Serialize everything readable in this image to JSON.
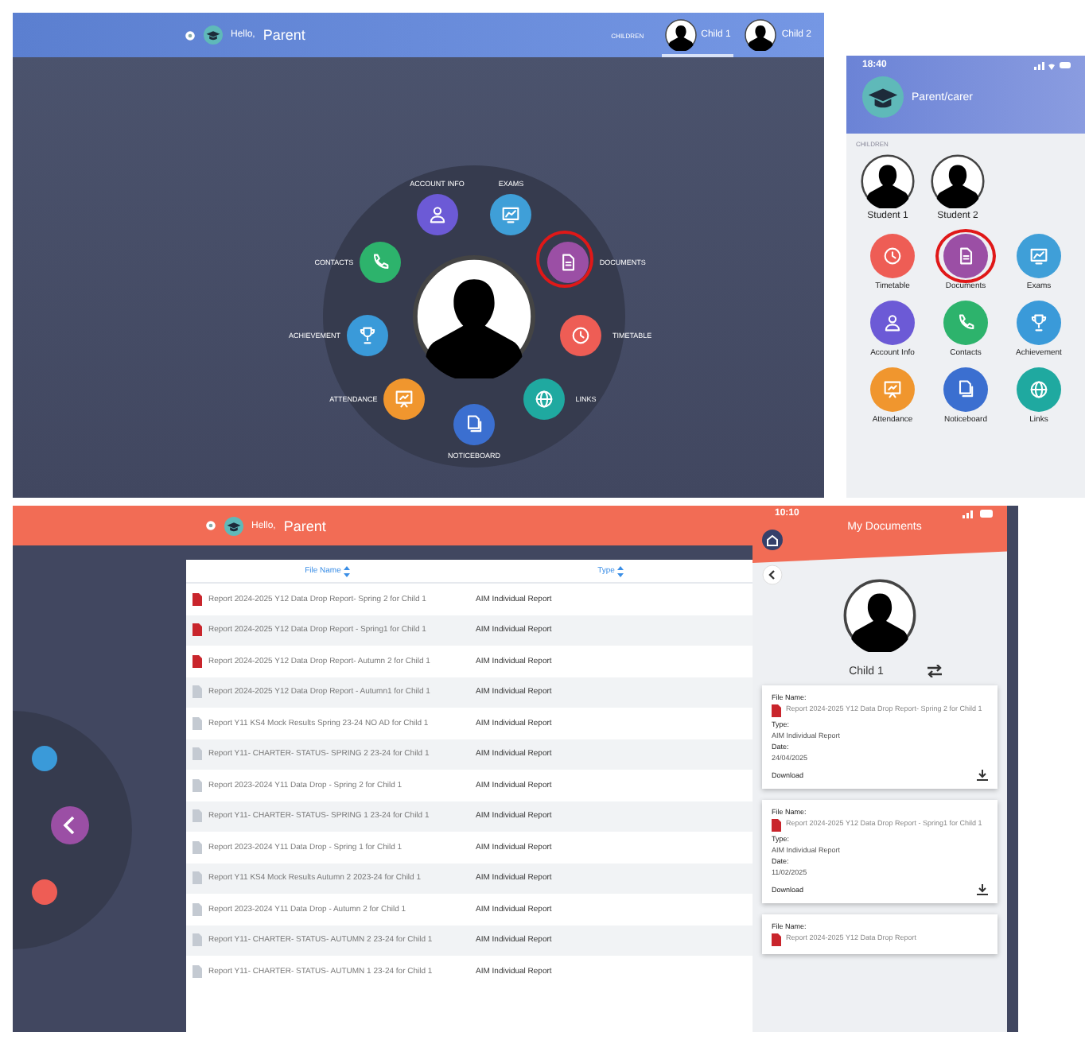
{
  "desktop_home": {
    "header": {
      "greeting": "Hello,",
      "user": "Parent",
      "children_label": "CHILDREN",
      "tabs": [
        {
          "label": "Child 1",
          "selected": true
        },
        {
          "label": "Child 2",
          "selected": false
        }
      ]
    },
    "menu": [
      {
        "label": "EXAMS",
        "color": "#3f9fd8",
        "selected": false
      },
      {
        "label": "DOCUMENTS",
        "color": "#9b4fa5",
        "selected": true
      },
      {
        "label": "TIMETABLE",
        "color": "#ee5d55",
        "selected": false
      },
      {
        "label": "LINKS",
        "color": "#1fa9a0",
        "selected": false
      },
      {
        "label": "NOTICEBOARD",
        "color": "#3b6fd0",
        "selected": false
      },
      {
        "label": "ATTENDANCE",
        "color": "#f0962e",
        "selected": false
      },
      {
        "label": "ACHIEVEMENT",
        "color": "#3a9ad9",
        "selected": false
      },
      {
        "label": "CONTACTS",
        "color": "#2db36c",
        "selected": false
      },
      {
        "label": "ACCOUNT INFO",
        "color": "#6c5ad6",
        "selected": false
      }
    ]
  },
  "mobile_home": {
    "time": "18:40",
    "title": "Parent/carer",
    "children_label": "CHILDREN",
    "students": [
      "Student 1",
      "Student 2"
    ],
    "menu": [
      {
        "label": "Timetable",
        "color": "#ee5d55",
        "selected": false
      },
      {
        "label": "Documents",
        "color": "#9b4fa5",
        "selected": true
      },
      {
        "label": "Exams",
        "color": "#3f9fd8",
        "selected": false
      },
      {
        "label": "Account Info",
        "color": "#6c5ad6",
        "selected": false
      },
      {
        "label": "Contacts",
        "color": "#2db36c",
        "selected": false
      },
      {
        "label": "Achievement",
        "color": "#3a9ad9",
        "selected": false
      },
      {
        "label": "Attendance",
        "color": "#f0962e",
        "selected": false
      },
      {
        "label": "Noticeboard",
        "color": "#3b6fd0",
        "selected": false
      },
      {
        "label": "Links",
        "color": "#1fa9a0",
        "selected": false
      }
    ]
  },
  "desktop_documents": {
    "header": {
      "greeting": "Hello,",
      "user": "Parent"
    },
    "table": {
      "columns": [
        "File Name",
        "Type"
      ],
      "rows": [
        {
          "kind": "pdf",
          "file_name": "Report 2024-2025 Y12 Data Drop Report- Spring 2 for Child 1",
          "type": "AIM Individual Report"
        },
        {
          "kind": "pdf",
          "file_name": "Report 2024-2025 Y12 Data Drop Report - Spring1 for Child 1",
          "type": "AIM Individual Report"
        },
        {
          "kind": "pdf",
          "file_name": "Report 2024-2025 Y12 Data Drop Report- Autumn 2 for Child 1",
          "type": "AIM Individual Report"
        },
        {
          "kind": "file",
          "file_name": "Report 2024-2025 Y12 Data Drop Report - Autumn1 for Child 1",
          "type": "AIM Individual Report"
        },
        {
          "kind": "file",
          "file_name": "Report Y11 KS4 Mock Results Spring 23-24 NO AD for Child 1",
          "type": "AIM Individual Report"
        },
        {
          "kind": "file",
          "file_name": "Report Y11- CHARTER- STATUS- SPRING 2 23-24 for Child 1",
          "type": "AIM Individual Report"
        },
        {
          "kind": "file",
          "file_name": "Report 2023-2024 Y11 Data Drop - Spring 2 for Child 1",
          "type": "AIM Individual Report"
        },
        {
          "kind": "file",
          "file_name": "Report Y11- CHARTER- STATUS- SPRING 1 23-24 for Child 1",
          "type": "AIM Individual Report"
        },
        {
          "kind": "file",
          "file_name": "Report 2023-2024 Y11 Data Drop - Spring 1 for Child 1",
          "type": "AIM Individual Report"
        },
        {
          "kind": "file",
          "file_name": "Report Y11 KS4 Mock Results Autumn 2 2023-24 for Child 1",
          "type": "AIM Individual Report"
        },
        {
          "kind": "file",
          "file_name": "Report 2023-2024 Y11 Data Drop - Autumn 2 for Child 1",
          "type": "AIM Individual Report"
        },
        {
          "kind": "file",
          "file_name": "Report Y11- CHARTER- STATUS- AUTUMN 2 23-24 for Child 1",
          "type": "AIM Individual Report"
        },
        {
          "kind": "file",
          "file_name": "Report Y11- CHARTER- STATUS- AUTUMN 1 23-24 for Child 1",
          "type": "AIM Individual Report"
        }
      ]
    }
  },
  "mobile_documents": {
    "time": "10:10",
    "title": "My Documents",
    "child": "Child 1",
    "cards": [
      {
        "file_name_label": "File Name:",
        "file_name": "Report 2024-2025 Y12 Data Drop Report- Spring 2 for Child 1",
        "type_label": "Type:",
        "type": "AIM Individual Report",
        "date_label": "Date:",
        "date": "24/04/2025",
        "download_label": "Download"
      },
      {
        "file_name_label": "File Name:",
        "file_name": "Report 2024-2025 Y12 Data Drop Report - Spring1 for Child 1",
        "type_label": "Type:",
        "type": "AIM Individual Report",
        "date_label": "Date:",
        "date": "11/02/2025",
        "download_label": "Download"
      },
      {
        "file_name_label": "File Name:",
        "file_name": "Report 2024-2025 Y12 Data Drop Report"
      }
    ]
  }
}
